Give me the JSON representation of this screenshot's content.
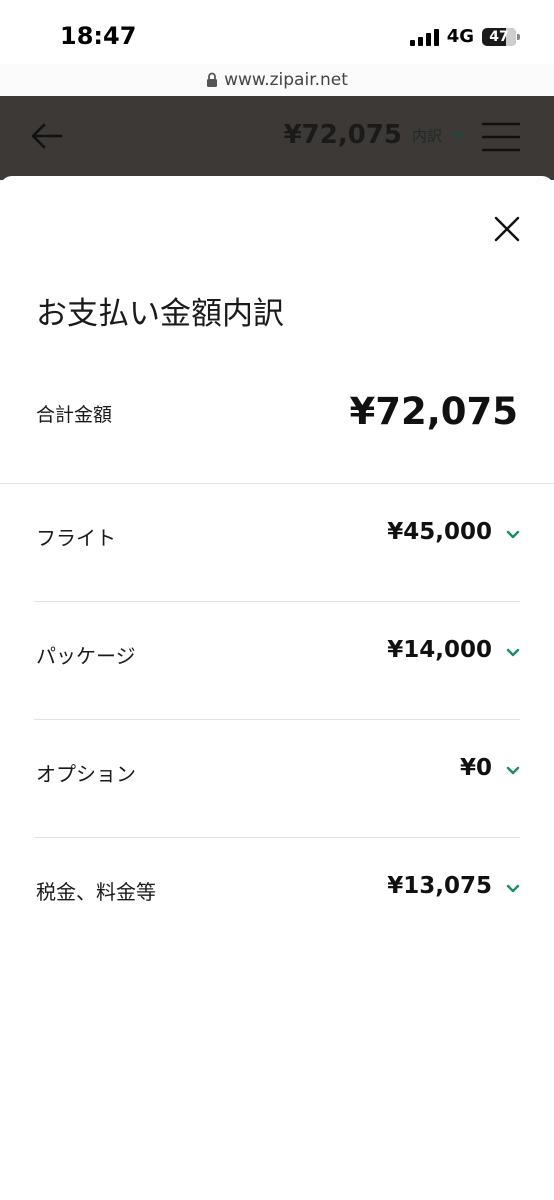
{
  "status_bar": {
    "time": "18:47",
    "network": "4G",
    "battery": "47"
  },
  "browser": {
    "url": "www.zipair.net"
  },
  "header": {
    "total_price": "¥72,075",
    "breakdown_label": "内訳"
  },
  "sheet": {
    "title": "お支払い金額内訳",
    "total_label": "合計金額",
    "total_value": "¥72,075",
    "items": [
      {
        "label": "フライト",
        "value": "¥45,000"
      },
      {
        "label": "パッケージ",
        "value": "¥14,000"
      },
      {
        "label": "オプション",
        "value": "¥0"
      },
      {
        "label": "税金、料金等",
        "value": "¥13,075"
      }
    ]
  },
  "colors": {
    "accent_green": "#1d8a6e",
    "header_background": "#3c3937"
  }
}
